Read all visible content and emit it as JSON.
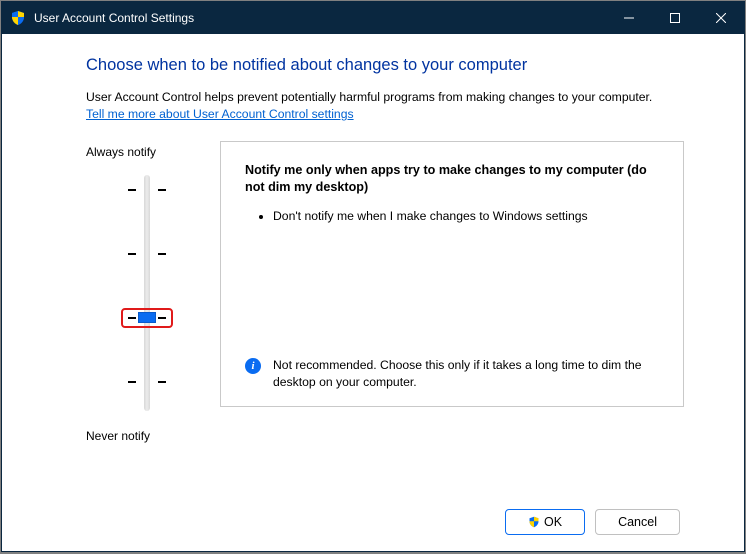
{
  "window": {
    "title": "User Account Control Settings"
  },
  "page": {
    "headline": "Choose when to be notified about changes to your computer",
    "intro_text": "User Account Control helps prevent potentially harmful programs from making changes to your computer.",
    "learn_more_link": "Tell me more about User Account Control settings"
  },
  "slider": {
    "top_label": "Always notify",
    "bottom_label": "Never notify",
    "levels": 4,
    "current_level": 2,
    "highlighted": true
  },
  "selection": {
    "title": "Notify me only when apps try to make changes to my computer (do not dim my desktop)",
    "bullets": [
      "Don't notify me when I make changes to Windows settings"
    ],
    "recommendation_icon": "info",
    "recommendation_text": "Not recommended. Choose this only if it takes a long time to dim the desktop on your computer."
  },
  "footer": {
    "ok_label": "OK",
    "cancel_label": "Cancel"
  }
}
